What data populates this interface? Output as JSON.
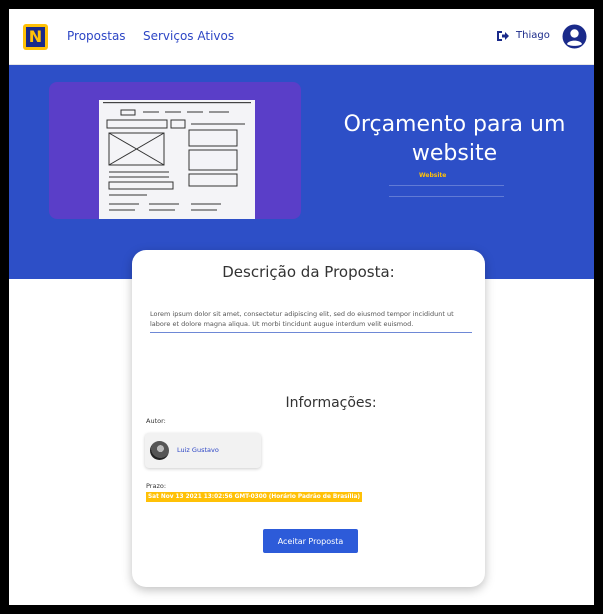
{
  "nav": {
    "logo_letter": "N",
    "links": [
      "Propostas",
      "Serviços Ativos"
    ],
    "user_name": "Thiago"
  },
  "hero": {
    "title": "Orçamento para um website",
    "tag": "Website"
  },
  "card": {
    "title": "Descrição da Proposta:",
    "description": "Lorem ipsum dolor sit amet, consectetur adipiscing elit, sed do eiusmod tempor incididunt ut labore et dolore magna aliqua. Ut morbi tincidunt augue interdum velit euismod.",
    "info_title": "Informações:",
    "author_label": "Autor:",
    "author_name": "Luiz Gustavo",
    "deadline_label": "Prazo:",
    "deadline_value": "Sat Nov 13 2021 13:02:56 GMT-0300 (Horário Padrão de Brasília)",
    "accept_button": "Aceitar Proposta"
  },
  "colors": {
    "primary": "#2d4fc7",
    "accent": "#ffc107",
    "link": "#2d46c5"
  }
}
